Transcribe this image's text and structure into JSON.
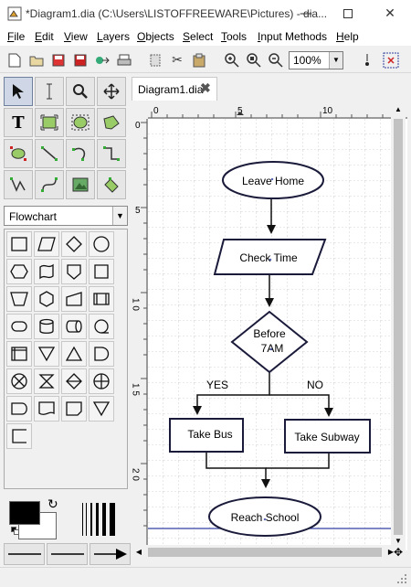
{
  "window": {
    "title": "*Diagram1.dia (C:\\Users\\LISTOFFREEWARE\\Pictures) - dia...",
    "minimize_icon": "minimize-icon",
    "maximize_icon": "maximize-icon",
    "close_icon": "close-icon"
  },
  "menu": {
    "items": [
      {
        "label": "File",
        "key": "F",
        "rest": "ile"
      },
      {
        "label": "Edit",
        "key": "E",
        "rest": "dit"
      },
      {
        "label": "View",
        "key": "V",
        "rest": "iew"
      },
      {
        "label": "Layers",
        "key": "L",
        "rest": "ayers"
      },
      {
        "label": "Objects",
        "key": "O",
        "rest": "bjects"
      },
      {
        "label": "Select",
        "key": "S",
        "rest": "elect"
      },
      {
        "label": "Tools",
        "key": "T",
        "rest": "ools"
      },
      {
        "label": "Input Methods",
        "key": "I",
        "rest": "nput Methods"
      },
      {
        "label": "Help",
        "key": "H",
        "rest": "elp"
      }
    ]
  },
  "toolbar": {
    "zoom": "100%"
  },
  "sheet": {
    "selected": "Flowchart"
  },
  "tab": {
    "label": "Diagram1.dia"
  },
  "rulers": {
    "h_ticks": [
      "0",
      "5",
      "10"
    ],
    "v_ticks": [
      "0",
      "5",
      "1 0",
      "1 5",
      "2 0"
    ]
  },
  "diagram": {
    "start": "Leave Home",
    "io": "Check Time",
    "decision_line1": "Before",
    "decision_line2": "7AM",
    "yes_label": "YES",
    "no_label": "NO",
    "left_process": "Take Bus",
    "right_process": "Take Subway",
    "end": "Reach School"
  },
  "colors": {
    "foreground": "#000000",
    "background": "#ffffff",
    "shape_stroke": "#1a1a3a",
    "accent_blue": "#3040a0"
  }
}
